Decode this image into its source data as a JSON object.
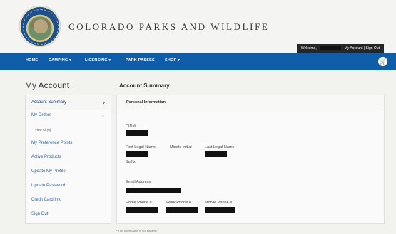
{
  "header": {
    "brand": "COLORADO PARKS AND WILDLIFE",
    "account_bar": {
      "welcome": "Welcome,",
      "links": "My Account | Sign Out"
    }
  },
  "nav": {
    "items": [
      "HOME",
      "CAMPING ▾",
      "LICENSING ▾",
      "PARK PASSES",
      "SHOP ▾"
    ],
    "cart_icon": "cart-icon"
  },
  "sidebar": {
    "title": "My Account",
    "items": [
      "Account Summary",
      "My Orders",
      "View All (0)",
      "My Preference Points",
      "Active Products",
      "Update My Profile",
      "Update Password",
      "Credit Card Info",
      "Sign Out"
    ]
  },
  "main": {
    "title": "Account Summary",
    "panel_title": "Personal Information",
    "labels": {
      "cid": "CID #",
      "first_name": "First Legal Name",
      "middle_initial": "Middle Initial",
      "last_name": "Last Legal Name",
      "suffix": "Suffix",
      "email": "Email Address",
      "home_phone": "Home Phone #",
      "work_phone": "Work Phone #",
      "mobile_phone": "Mobile Phone #"
    },
    "note": "* This information is not editable"
  },
  "colors": {
    "nav_blue": "#0f5da9",
    "redaction": "#111111"
  }
}
